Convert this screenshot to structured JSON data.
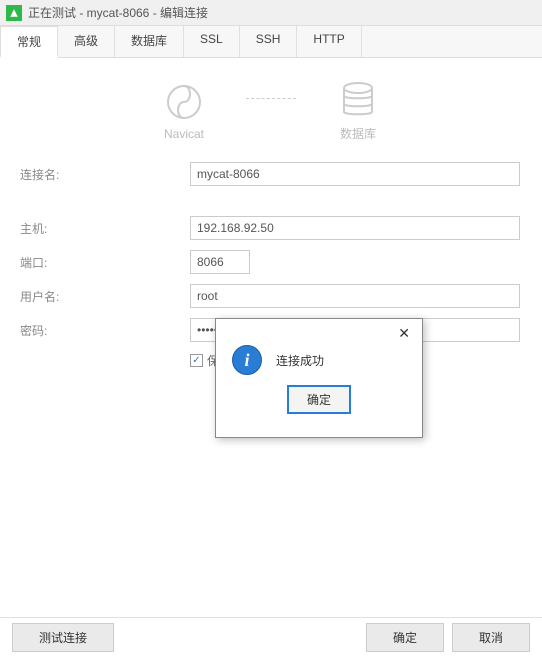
{
  "window": {
    "title": "正在测试 - mycat-8066 - 编辑连接"
  },
  "tabs": {
    "general": "常规",
    "advanced": "高级",
    "database": "数据库",
    "ssl": "SSL",
    "ssh": "SSH",
    "http": "HTTP"
  },
  "diagram": {
    "left_label": "Navicat",
    "right_label": "数据库"
  },
  "form": {
    "conn_name_label": "连接名:",
    "conn_name_value": "mycat-8066",
    "host_label": "主机:",
    "host_value": "192.168.92.50",
    "port_label": "端口:",
    "port_value": "8066",
    "user_label": "用户名:",
    "user_value": "root",
    "password_label": "密码:",
    "password_value": "••••••••",
    "save_password_label": "保存密码"
  },
  "dialog": {
    "message": "连接成功",
    "ok_label": "确定"
  },
  "footer": {
    "test_label": "测试连接",
    "ok_label": "确定",
    "cancel_label": "取消"
  }
}
